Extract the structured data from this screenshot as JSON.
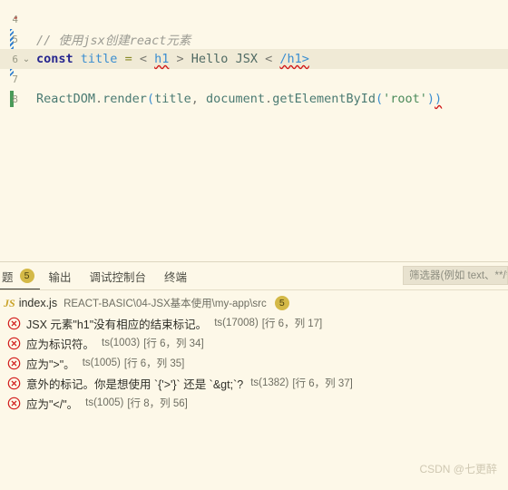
{
  "editor": {
    "lines": [
      {
        "num": "4",
        "fold": "",
        "marker": "dot",
        "highlight": false,
        "tokens": []
      },
      {
        "num": "5",
        "fold": "",
        "marker": "changed",
        "highlight": false,
        "tokens": [
          {
            "cls": "t-comment",
            "text": "// 使用jsx创建react元素"
          }
        ]
      },
      {
        "num": "6",
        "fold": "chevron-down",
        "marker": "changed",
        "highlight": true,
        "tokens": [
          {
            "cls": "t-keyword",
            "text": "const"
          },
          {
            "cls": "t-plain",
            "text": " "
          },
          {
            "cls": "t-var",
            "text": "title"
          },
          {
            "cls": "t-plain",
            "text": " "
          },
          {
            "cls": "t-op",
            "text": "="
          },
          {
            "cls": "t-plain",
            "text": " "
          },
          {
            "cls": "t-punct",
            "text": "<"
          },
          {
            "cls": "t-plain",
            "text": " "
          },
          {
            "cls": "t-tag squiggle-wave",
            "text": "h1"
          },
          {
            "cls": "t-plain",
            "text": " "
          },
          {
            "cls": "t-punct",
            "text": ">"
          },
          {
            "cls": "t-plain",
            "text": " Hello JSX "
          },
          {
            "cls": "t-punct",
            "text": "<"
          },
          {
            "cls": "t-plain",
            "text": " "
          },
          {
            "cls": "t-tag squiggle-wave",
            "text": "/h1>"
          }
        ]
      },
      {
        "num": "7",
        "fold": "",
        "marker": "changed-thin",
        "highlight": false,
        "tokens": []
      },
      {
        "num": "8",
        "fold": "",
        "marker": "added",
        "highlight": false,
        "tokens": [
          {
            "cls": "t-ident",
            "text": "ReactDOM"
          },
          {
            "cls": "t-punct",
            "text": "."
          },
          {
            "cls": "t-ident",
            "text": "render"
          },
          {
            "cls": "t-paren",
            "text": "("
          },
          {
            "cls": "t-ident",
            "text": "title"
          },
          {
            "cls": "t-punct",
            "text": ","
          },
          {
            "cls": "t-plain",
            "text": " "
          },
          {
            "cls": "t-ident",
            "text": "document"
          },
          {
            "cls": "t-punct",
            "text": "."
          },
          {
            "cls": "t-ident",
            "text": "getElementById"
          },
          {
            "cls": "t-paren",
            "text": "("
          },
          {
            "cls": "t-string",
            "text": "'root'"
          },
          {
            "cls": "t-paren",
            "text": ")"
          },
          {
            "cls": "t-paren squiggle-wave",
            "text": ")"
          }
        ]
      }
    ]
  },
  "panel": {
    "tabs": [
      {
        "label": "题",
        "badge": "5",
        "active": true,
        "name": "tab-problems"
      },
      {
        "label": "输出",
        "badge": "",
        "active": false,
        "name": "tab-output"
      },
      {
        "label": "调试控制台",
        "badge": "",
        "active": false,
        "name": "tab-debug-console"
      },
      {
        "label": "终端",
        "badge": "",
        "active": false,
        "name": "tab-terminal"
      }
    ],
    "filter": {
      "placeholder": "筛选器(例如 text、**/*.ts、!**/node_modules/**)",
      "value": ""
    },
    "file": {
      "icon_letter": "JS",
      "name": "index.js",
      "path": "REACT-BASIC\\04-JSX基本使用\\my-app\\src",
      "badge": "5"
    },
    "problems": [
      {
        "severity": "error",
        "message": "JSX 元素\"h1\"没有相应的结束标记。",
        "code": "ts(17008)",
        "location": "[行 6，列 17]"
      },
      {
        "severity": "error",
        "message": "应为标识符。",
        "code": "ts(1003)",
        "location": "[行 6，列 34]"
      },
      {
        "severity": "error",
        "message": "应为\">\"。",
        "code": "ts(1005)",
        "location": "[行 6，列 35]"
      },
      {
        "severity": "error",
        "message": "意外的标记。你是想使用 `{'>'}` 还是 `&gt;`?",
        "code": "ts(1382)",
        "location": "[行 6，列 37]"
      },
      {
        "severity": "error",
        "message": "应为\"</\"。",
        "code": "ts(1005)",
        "location": "[行 8，列 56]"
      }
    ]
  },
  "watermark": {
    "text": "CSDN @七更醉"
  },
  "colors": {
    "background": "#fdf8e8",
    "badge": "#d4b947",
    "error": "#d11a1a",
    "keyword": "#26268f",
    "variable": "#3b8ed0",
    "comment": "#9b9b93",
    "string": "#4a8a5a"
  }
}
